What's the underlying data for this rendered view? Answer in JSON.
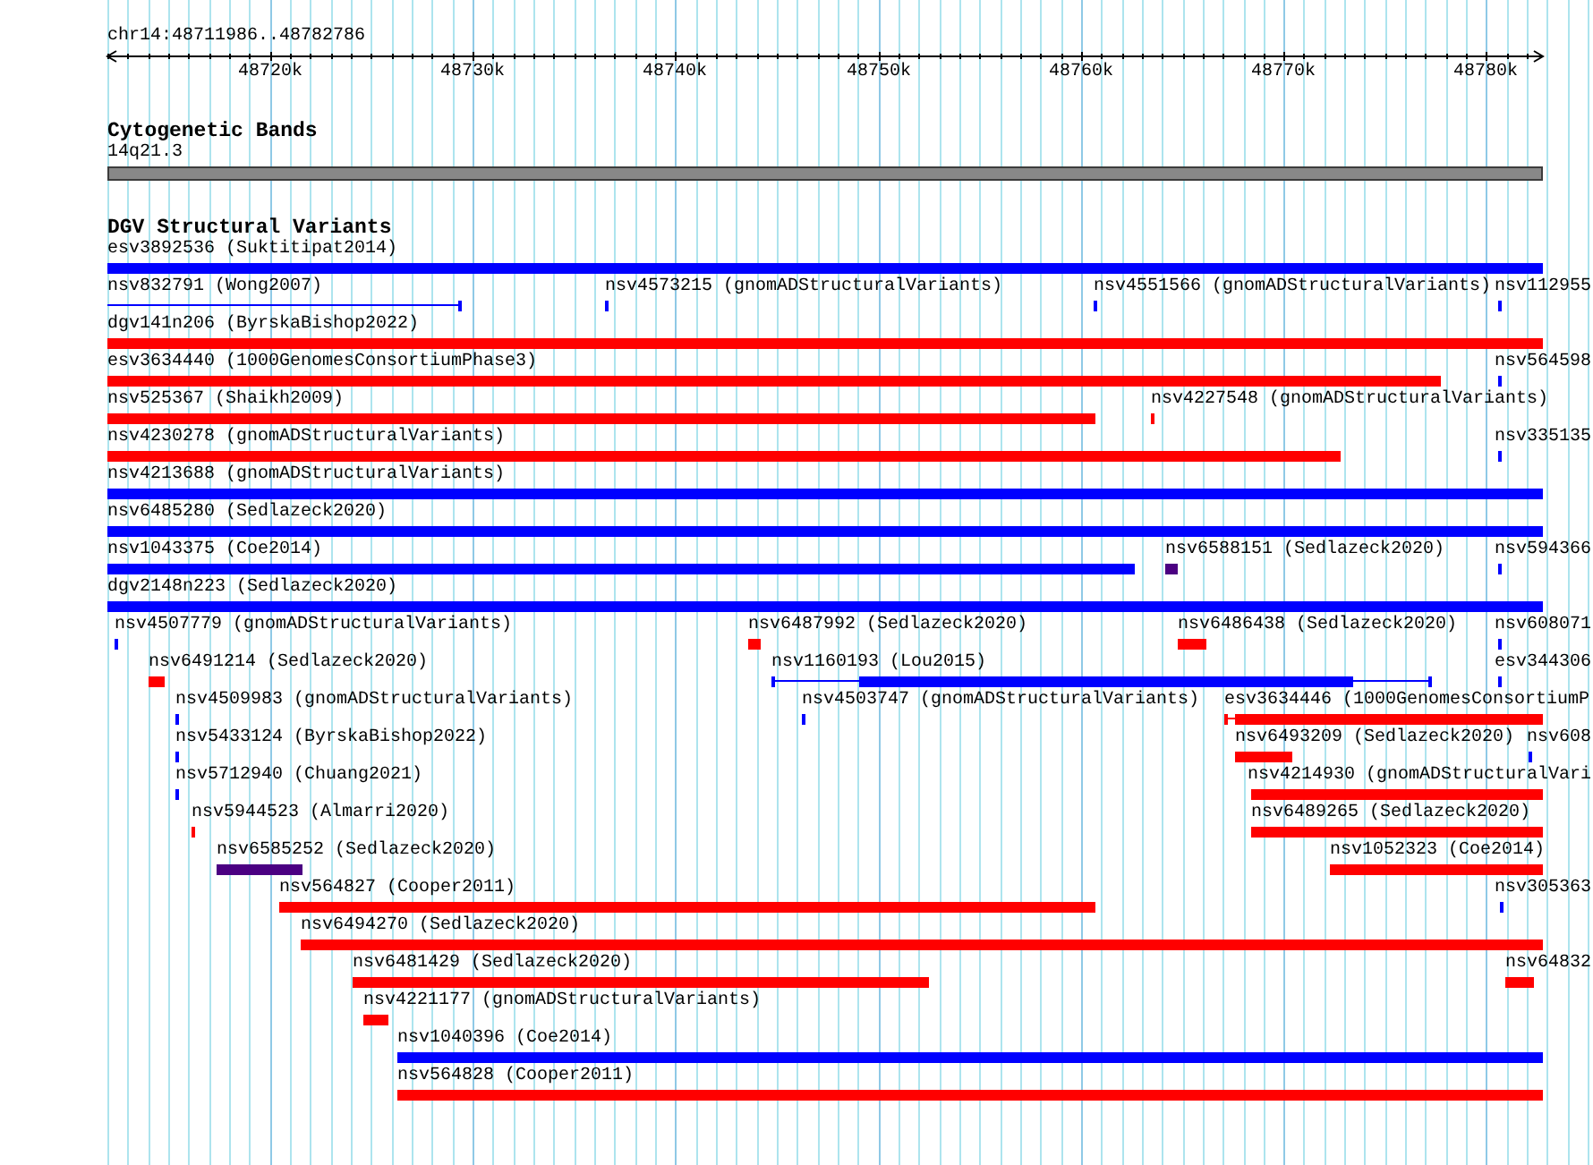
{
  "location": "chr14:48711986..48782786",
  "ruler": {
    "ticks": [
      "48720k",
      "48730k",
      "48740k",
      "48750k",
      "48760k",
      "48770k",
      "48780k"
    ]
  },
  "cytoband_track": {
    "title": "Cytogenetic Bands",
    "band": "14q21.3"
  },
  "variant_track": {
    "title": "DGV Structural Variants",
    "rows": [
      {
        "features": [
          {
            "label": "esv3892536 (Suktitipat2014)",
            "kind": "block",
            "color": "#0000ff"
          }
        ]
      },
      {
        "features": [
          {
            "label": "nsv832791 (Wong2007)",
            "kind": "span",
            "color": "#0000ff"
          },
          {
            "label": "nsv4573215 (gnomADStructuralVariants)",
            "kind": "block",
            "color": "#0000ff"
          },
          {
            "label": "nsv4551566 (gnomADStructuralVariants)",
            "kind": "block",
            "color": "#0000ff"
          },
          {
            "label": "nsv112955",
            "kind": "block",
            "color": "#0000ff"
          }
        ]
      },
      {
        "features": [
          {
            "label": "dgv141n206 (ByrskaBishop2022)",
            "kind": "block",
            "color": "#ff0000"
          }
        ]
      },
      {
        "features": [
          {
            "label": "esv3634440 (1000GenomesConsortiumPhase3)",
            "kind": "block",
            "color": "#ff0000"
          },
          {
            "label": "nsv564598",
            "kind": "block",
            "color": "#0000ff"
          }
        ]
      },
      {
        "features": [
          {
            "label": "nsv525367 (Shaikh2009)",
            "kind": "block",
            "color": "#ff0000"
          },
          {
            "label": "nsv4227548 (gnomADStructuralVariants)",
            "kind": "block",
            "color": "#ff0000"
          }
        ]
      },
      {
        "features": [
          {
            "label": "nsv4230278 (gnomADStructuralVariants)",
            "kind": "block",
            "color": "#ff0000"
          },
          {
            "label": "nsv335135",
            "kind": "block",
            "color": "#0000ff"
          }
        ]
      },
      {
        "features": [
          {
            "label": "nsv4213688 (gnomADStructuralVariants)",
            "kind": "block",
            "color": "#0000ff"
          }
        ]
      },
      {
        "features": [
          {
            "label": "nsv6485280 (Sedlazeck2020)",
            "kind": "block",
            "color": "#0000ff"
          }
        ]
      },
      {
        "features": [
          {
            "label": "nsv1043375 (Coe2014)",
            "kind": "block",
            "color": "#0000ff"
          },
          {
            "label": "nsv6588151 (Sedlazeck2020)",
            "kind": "block",
            "color": "#4b0082"
          },
          {
            "label": "nsv594366",
            "kind": "block",
            "color": "#0000ff"
          }
        ]
      },
      {
        "features": [
          {
            "label": "dgv2148n223 (Sedlazeck2020)",
            "kind": "block",
            "color": "#0000ff"
          }
        ]
      },
      {
        "features": [
          {
            "label": "nsv4507779 (gnomADStructuralVariants)",
            "kind": "block",
            "color": "#0000ff"
          },
          {
            "label": "nsv6487992 (Sedlazeck2020)",
            "kind": "block",
            "color": "#ff0000"
          },
          {
            "label": "nsv6486438 (Sedlazeck2020)",
            "kind": "block",
            "color": "#ff0000"
          },
          {
            "label": "nsv608071",
            "kind": "block",
            "color": "#0000ff"
          }
        ]
      },
      {
        "features": [
          {
            "label": "nsv6491214 (Sedlazeck2020)",
            "kind": "block",
            "color": "#ff0000"
          },
          {
            "label": "nsv1160193 (Lou2015)",
            "kind": "span",
            "color": "#0000ff"
          },
          {
            "label": "esv344306",
            "kind": "block",
            "color": "#0000ff"
          }
        ]
      },
      {
        "features": [
          {
            "label": "nsv4509983 (gnomADStructuralVariants)",
            "kind": "block",
            "color": "#0000ff"
          },
          {
            "label": "nsv4503747 (gnomADStructuralVariants)",
            "kind": "block",
            "color": "#0000ff"
          },
          {
            "label": "esv3634446 (1000GenomesConsortiumP",
            "kind": "span",
            "color": "#ff0000"
          }
        ]
      },
      {
        "features": [
          {
            "label": "nsv5433124 (ByrskaBishop2022)",
            "kind": "block",
            "color": "#0000ff"
          },
          {
            "label": "nsv6493209 (Sedlazeck2020)",
            "kind": "block",
            "color": "#ff0000"
          },
          {
            "label": "nsv608",
            "kind": "block",
            "color": "#0000ff"
          }
        ]
      },
      {
        "features": [
          {
            "label": "nsv5712940 (Chuang2021)",
            "kind": "block",
            "color": "#0000ff"
          },
          {
            "label": "nsv4214930 (gnomADStructuralVari",
            "kind": "block",
            "color": "#ff0000"
          }
        ]
      },
      {
        "features": [
          {
            "label": "nsv5944523 (Almarri2020)",
            "kind": "block",
            "color": "#ff0000"
          },
          {
            "label": "nsv6489265 (Sedlazeck2020)",
            "kind": "block",
            "color": "#ff0000"
          }
        ]
      },
      {
        "features": [
          {
            "label": "nsv6585252 (Sedlazeck2020)",
            "kind": "block",
            "color": "#4b0082"
          },
          {
            "label": "nsv1052323 (Coe2014)",
            "kind": "block",
            "color": "#ff0000"
          }
        ]
      },
      {
        "features": [
          {
            "label": "nsv564827 (Cooper2011)",
            "kind": "block",
            "color": "#ff0000"
          },
          {
            "label": "nsv305363",
            "kind": "block",
            "color": "#0000ff"
          }
        ]
      },
      {
        "features": [
          {
            "label": "nsv6494270 (Sedlazeck2020)",
            "kind": "block",
            "color": "#ff0000"
          }
        ]
      },
      {
        "features": [
          {
            "label": "nsv6481429 (Sedlazeck2020)",
            "kind": "block",
            "color": "#ff0000"
          },
          {
            "label": "nsv64832",
            "kind": "block",
            "color": "#ff0000"
          }
        ]
      },
      {
        "features": [
          {
            "label": "nsv4221177 (gnomADStructuralVariants)",
            "kind": "block",
            "color": "#ff0000"
          }
        ]
      },
      {
        "features": [
          {
            "label": "nsv1040396 (Coe2014)",
            "kind": "block",
            "color": "#0000ff"
          }
        ]
      },
      {
        "features": [
          {
            "label": "nsv564828 (Cooper2011)",
            "kind": "block",
            "color": "#ff0000"
          }
        ]
      }
    ]
  }
}
